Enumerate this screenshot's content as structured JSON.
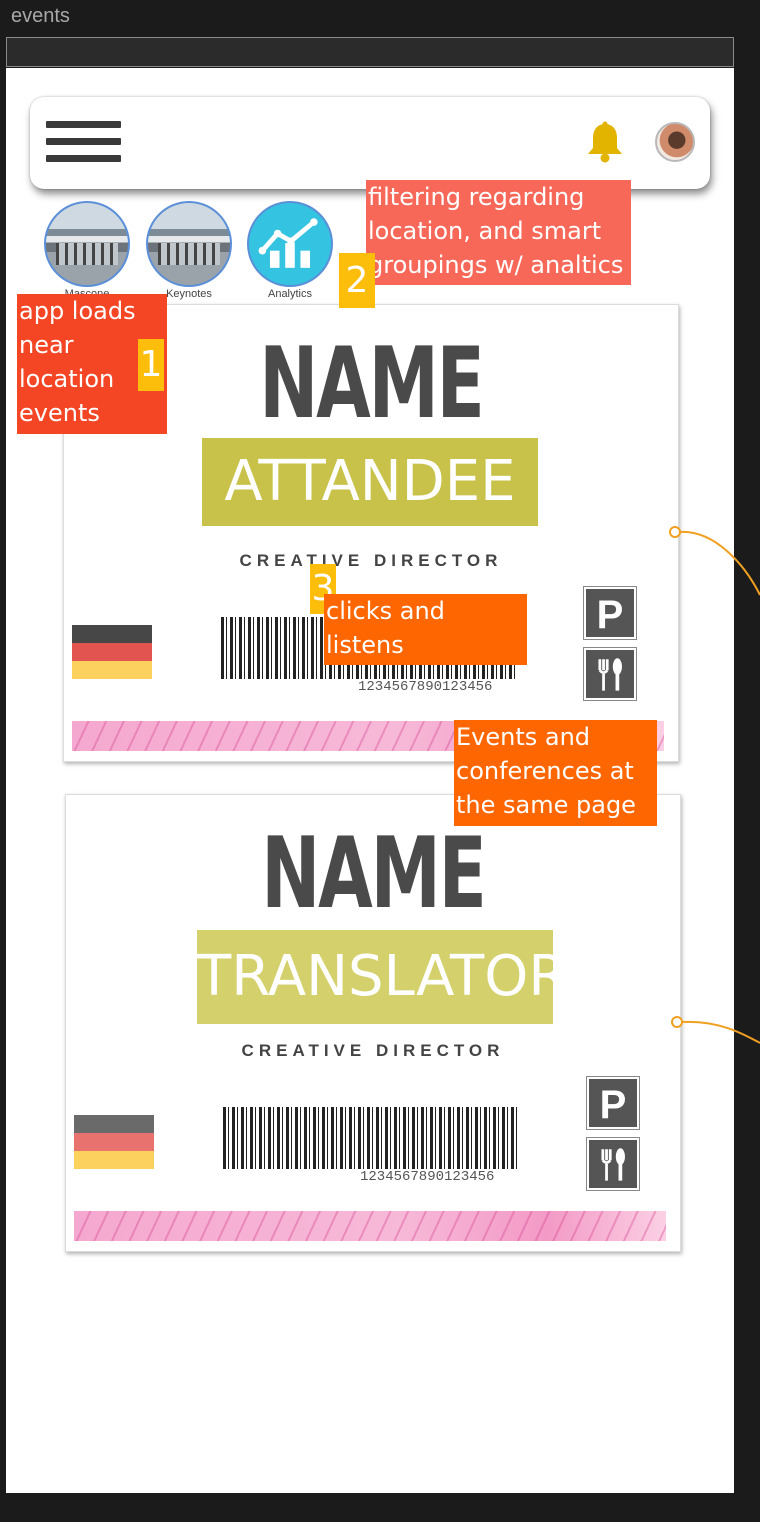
{
  "frame": {
    "title": "events"
  },
  "topbar": {
    "menu_icon": "hamburger-menu-icon",
    "bell_icon": "bell-icon",
    "avatar_icon": "avatar"
  },
  "categories": [
    {
      "label": "Mascone",
      "icon": "venue-photo"
    },
    {
      "label": "Keynotes",
      "icon": "venue-photo"
    },
    {
      "label": "Analytics",
      "icon": "analytics-chart-icon"
    }
  ],
  "badges": [
    {
      "name": "NAME",
      "role": "ATTANDEE",
      "title": "CREATIVE DIRECTOR",
      "barcode_number": "1234567890123456"
    },
    {
      "name": "NAME",
      "role": "TRANSLATOR",
      "title": "CREATIVE DIRECTOR",
      "barcode_number": "1234567890123456"
    }
  ],
  "annotations": {
    "note1": "app loads near location events",
    "marker1": "1",
    "note2": "filtering regarding location, and smart groupings w/ analtics",
    "marker2": "2",
    "note3": "clicks and listens",
    "marker3": "3",
    "note4": "Events and conferences at the same page"
  },
  "colors": {
    "role_highlight": "#c8c24a",
    "note_red": "#f44524",
    "note_orange": "#fe6602",
    "marker_yellow": "#fcbe0b",
    "bell": "#e2b400"
  }
}
